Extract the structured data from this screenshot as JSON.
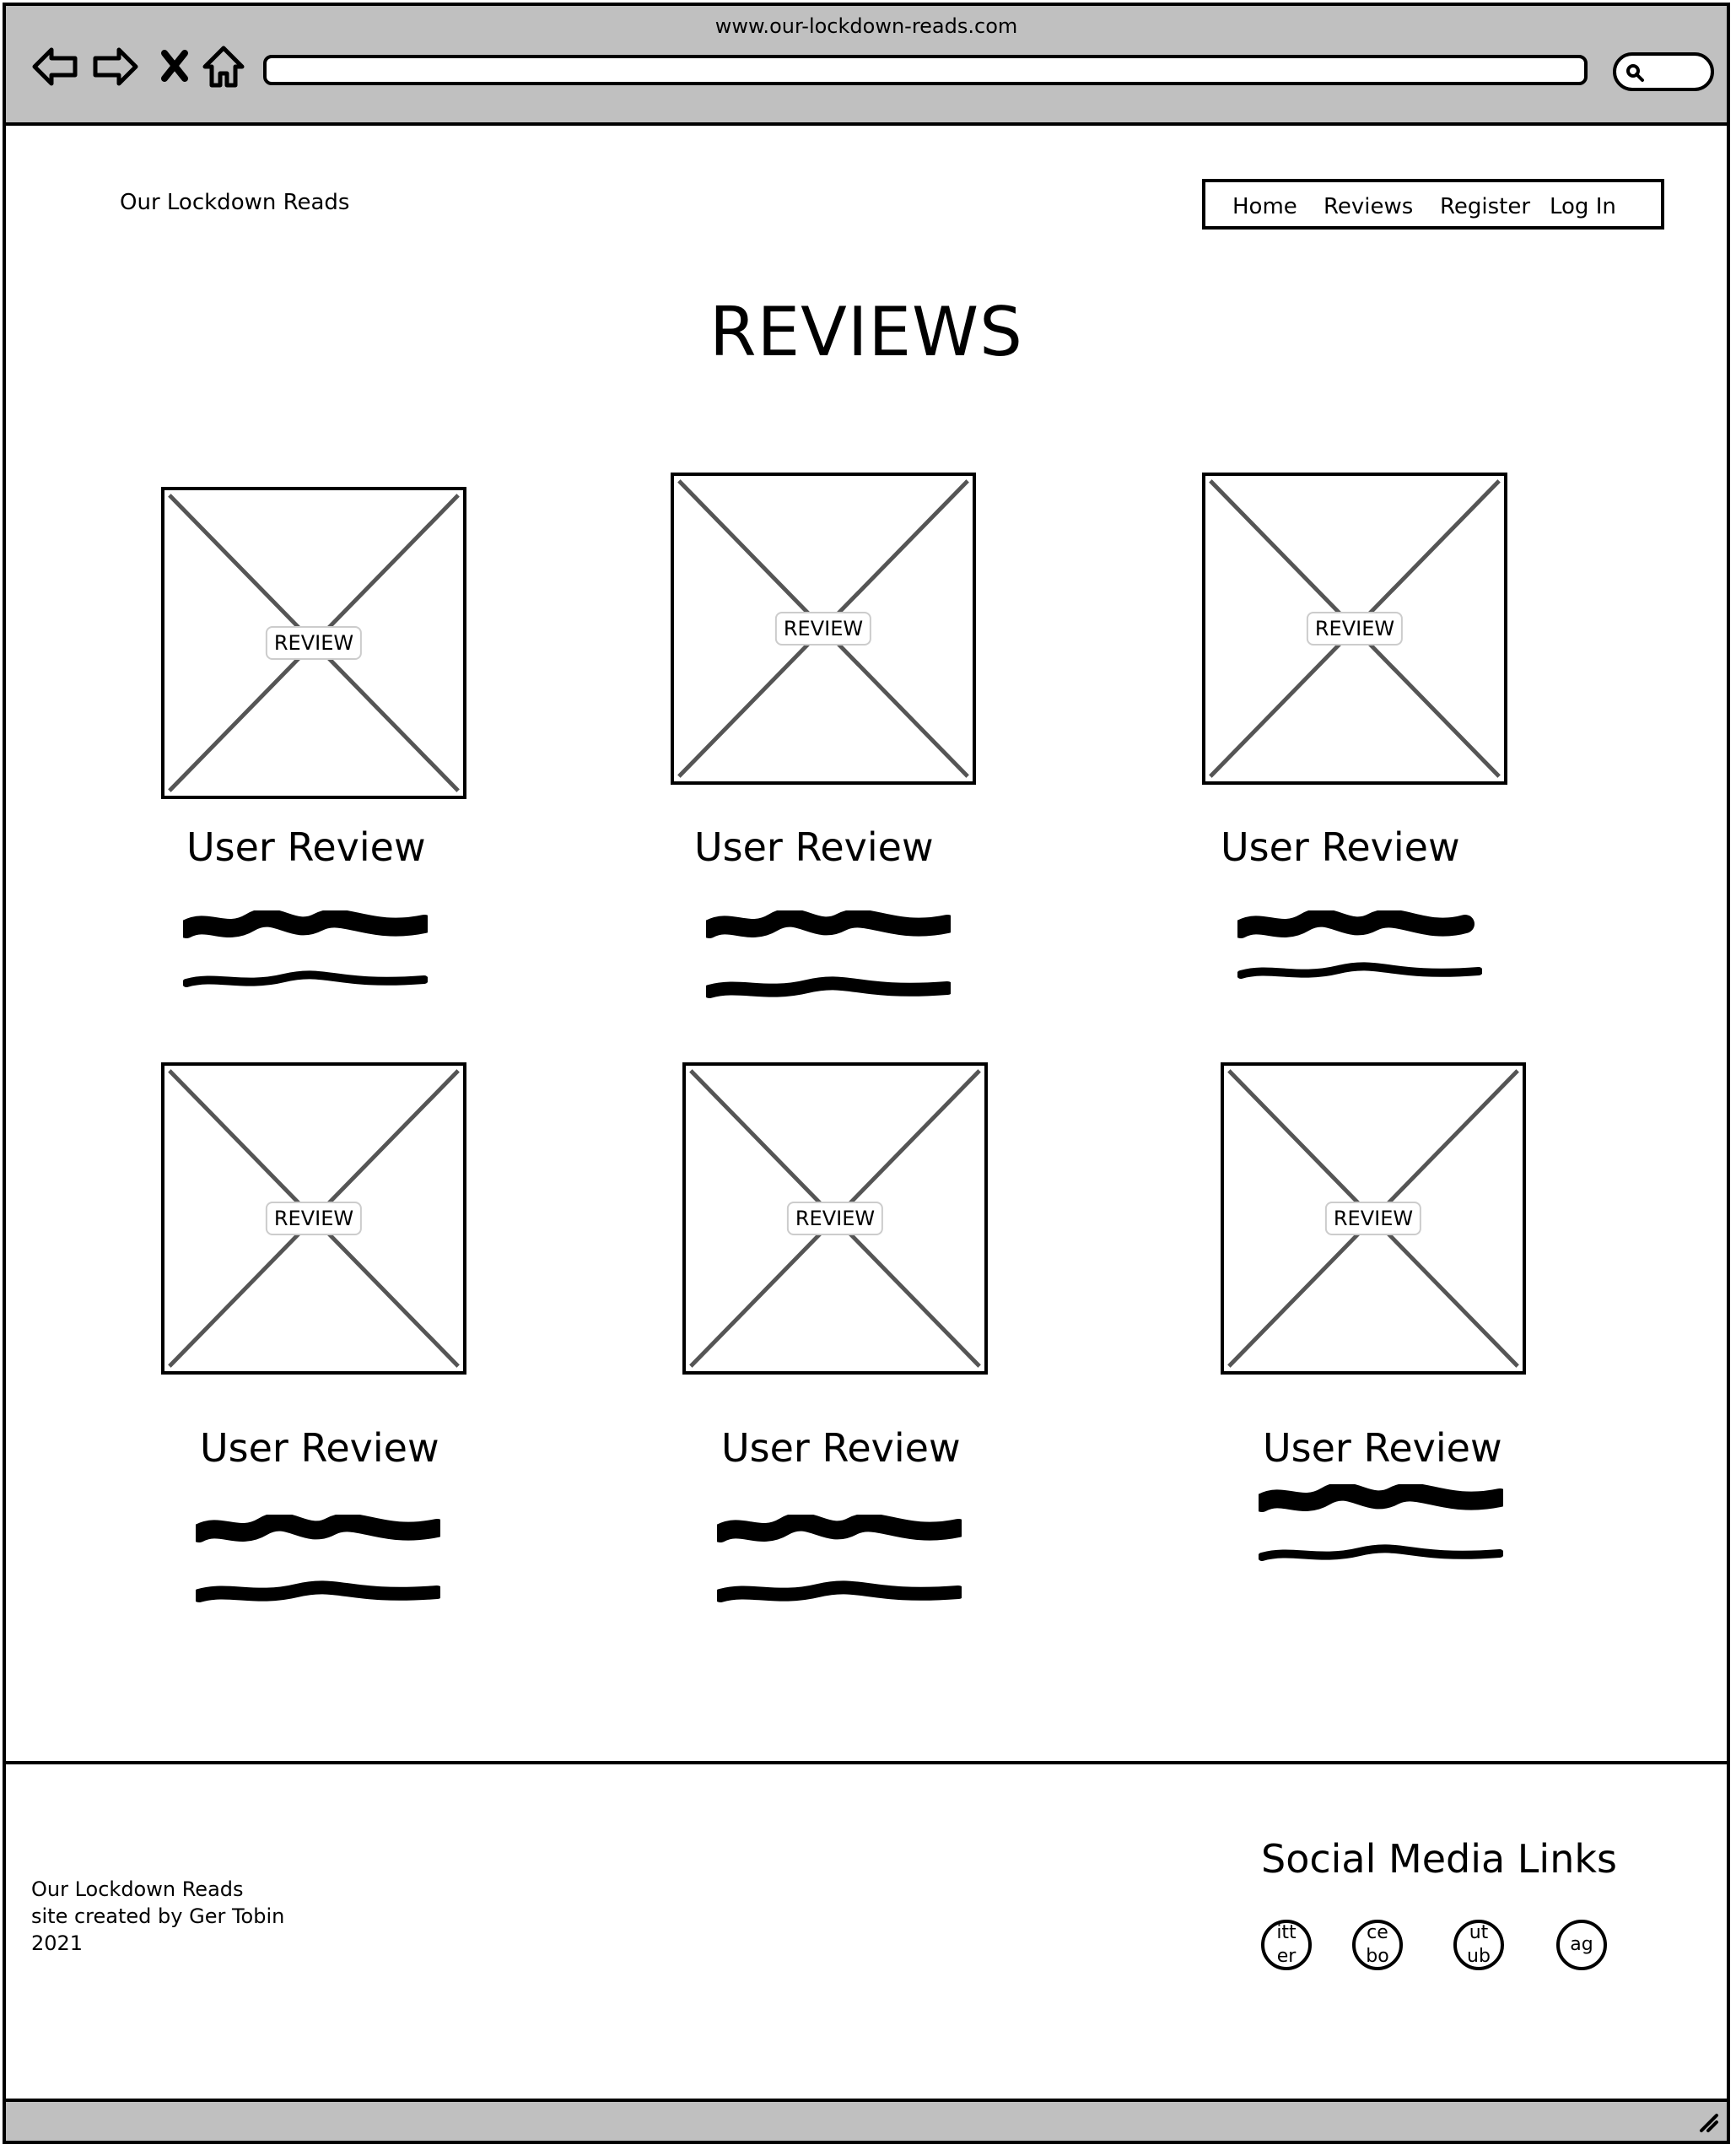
{
  "browser": {
    "url": "www.our-lockdown-reads.com"
  },
  "header": {
    "brand": "Our Lockdown Reads",
    "nav": [
      "Home",
      "Reviews",
      "Register",
      "Log In"
    ]
  },
  "page_title": "REVIEWS",
  "cards": [
    {
      "image_label": "REVIEW",
      "heading": "User Review"
    },
    {
      "image_label": "REVIEW",
      "heading": "User Review"
    },
    {
      "image_label": "REVIEW",
      "heading": "User Review"
    },
    {
      "image_label": "REVIEW",
      "heading": "User Review"
    },
    {
      "image_label": "REVIEW",
      "heading": "User Review"
    },
    {
      "image_label": "REVIEW",
      "heading": "User Review"
    }
  ],
  "footer": {
    "line1": "Our Lockdown Reads",
    "line2": "site created by Ger Tobin",
    "line3": "2021",
    "social_title": "Social Media Links",
    "social_icons": [
      {
        "name": "twitter-icon",
        "text": "itt er"
      },
      {
        "name": "facebook-icon",
        "text": "ce bo"
      },
      {
        "name": "youtube-icon",
        "text": "ut ub"
      },
      {
        "name": "instagram-icon",
        "text": "ag"
      }
    ]
  },
  "colors": {
    "chrome": "#c0c0c0",
    "border": "#000000",
    "cross": "#555555"
  }
}
